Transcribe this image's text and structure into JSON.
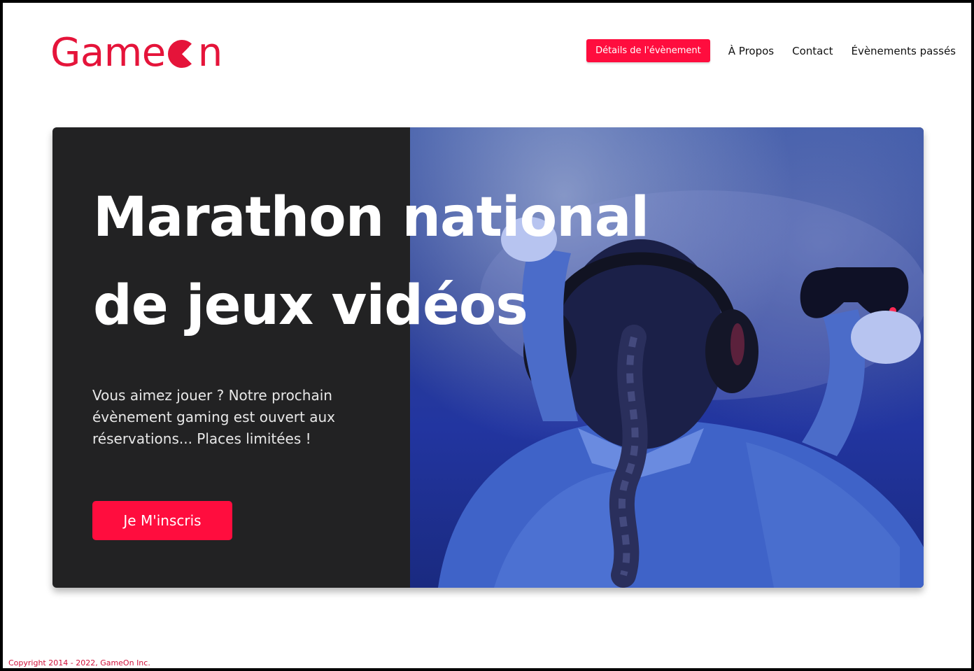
{
  "header": {
    "logo_before": "Game",
    "logo_after": "n",
    "nav": [
      {
        "label": "Détails de l'évènement",
        "active": true
      },
      {
        "label": "À Propos",
        "active": false
      },
      {
        "label": "Contact",
        "active": false
      },
      {
        "label": "Évènements passés",
        "active": false
      }
    ]
  },
  "hero": {
    "title_line1": "Marathon national",
    "title_line2": "de jeux vidéos",
    "text": "Vous aimez jouer ? Notre prochain évènement gaming est ouvert aux réservations... Places limitées !",
    "cta_label": "Je M'inscris",
    "image_icon": "gamer-with-headset-and-controller"
  },
  "footer": {
    "copyright": "Copyright 2014 - 2022, GameOn Inc."
  },
  "colors": {
    "accent": "#ff0d3e",
    "logo": "#e5143a",
    "hero_bg": "#222223"
  }
}
